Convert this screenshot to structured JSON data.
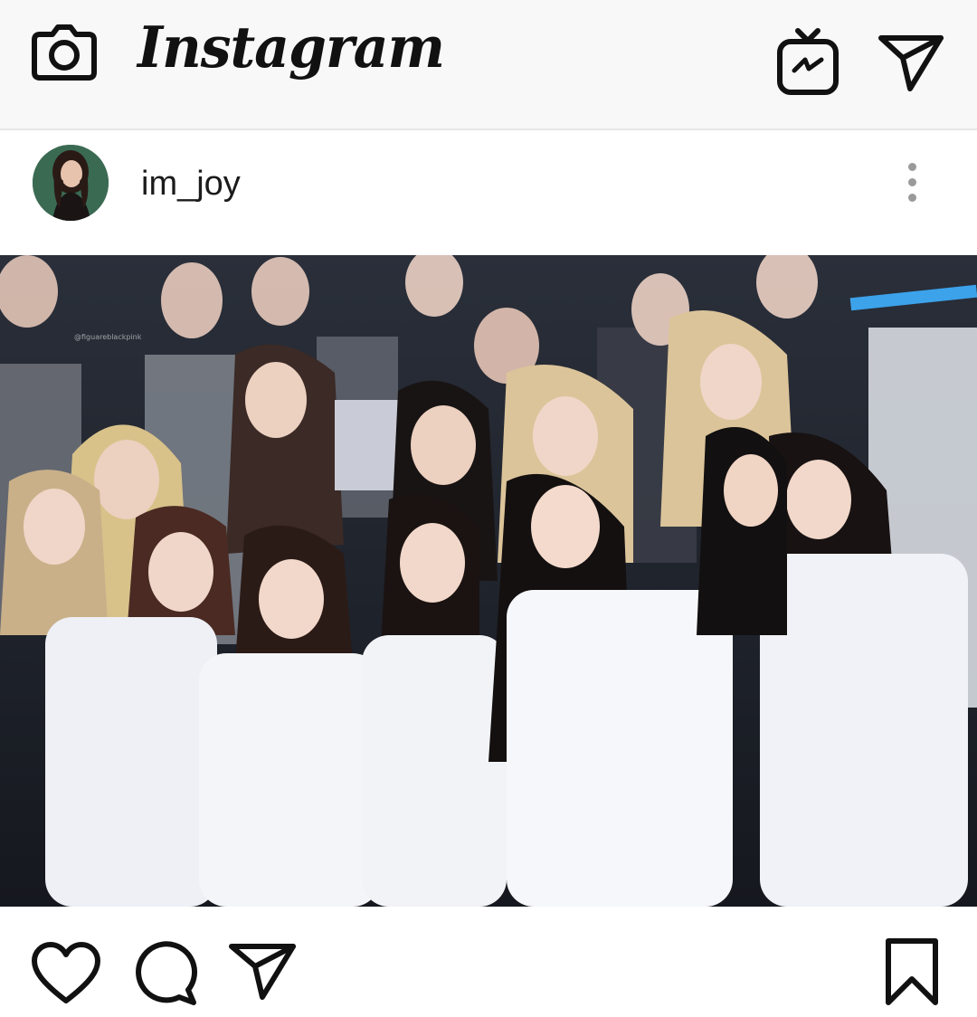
{
  "app": {
    "title": "Instagram"
  },
  "post": {
    "username": "im_joy",
    "photo_watermark": "@figuareblackpink"
  },
  "icons": {
    "camera": "camera-icon",
    "igtv": "igtv-icon",
    "direct": "direct-message-icon",
    "more": "more-options-icon",
    "like": "heart-icon",
    "comment": "comment-icon",
    "share": "share-icon",
    "save": "bookmark-icon"
  },
  "colors": {
    "icon": "#111111",
    "topbar_bg": "#f8f8f8",
    "text": "#1b1b1b"
  }
}
